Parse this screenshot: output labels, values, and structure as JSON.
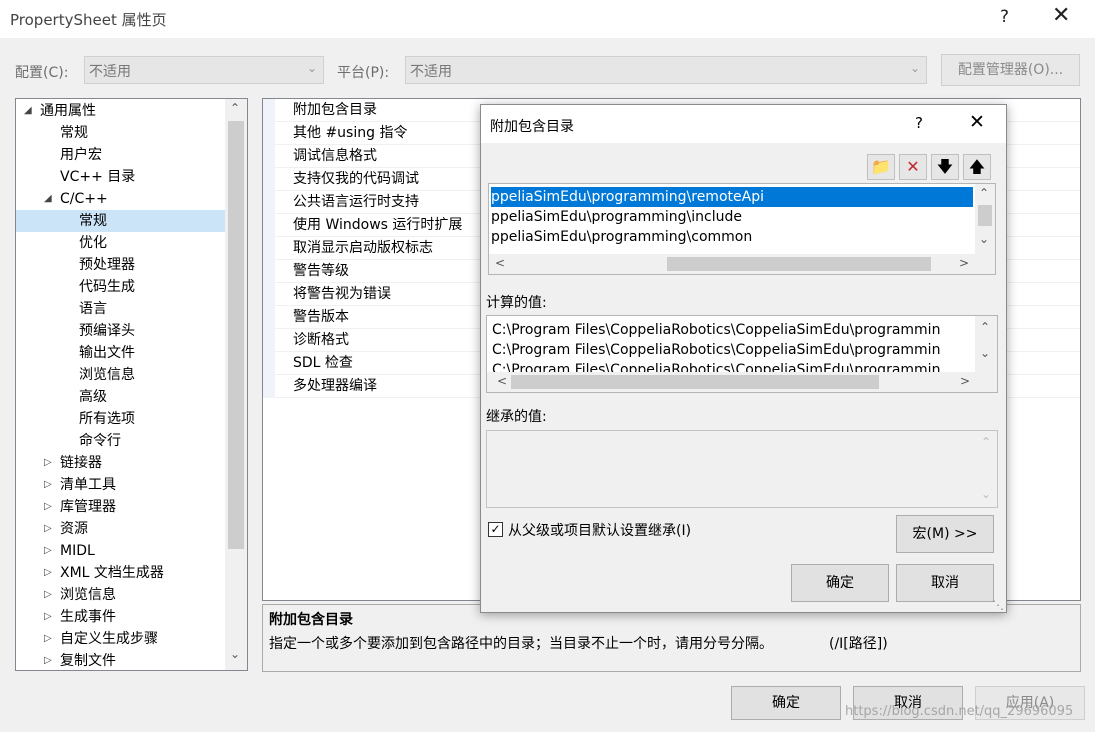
{
  "window": {
    "title": "PropertySheet 属性页",
    "help": "?",
    "close": "✕"
  },
  "config": {
    "label": "配置(C):",
    "value": "不适用",
    "platform_label": "平台(P):",
    "platform_value": "不适用",
    "manager_button": "配置管理器(O)..."
  },
  "tree": {
    "items": [
      {
        "label": "通用属性",
        "toggle": "◢"
      },
      {
        "label": "常规"
      },
      {
        "label": "用户宏"
      },
      {
        "label": "VC++ 目录"
      },
      {
        "label": "C/C++",
        "toggle": "◢"
      },
      {
        "label": "常规"
      },
      {
        "label": "优化"
      },
      {
        "label": "预处理器"
      },
      {
        "label": "代码生成"
      },
      {
        "label": "语言"
      },
      {
        "label": "预编译头"
      },
      {
        "label": "输出文件"
      },
      {
        "label": "浏览信息"
      },
      {
        "label": "高级"
      },
      {
        "label": "所有选项"
      },
      {
        "label": "命令行"
      },
      {
        "label": "链接器",
        "toggle": "▷"
      },
      {
        "label": "清单工具",
        "toggle": "▷"
      },
      {
        "label": "库管理器",
        "toggle": "▷"
      },
      {
        "label": "资源",
        "toggle": "▷"
      },
      {
        "label": "MIDL",
        "toggle": "▷"
      },
      {
        "label": "XML 文档生成器",
        "toggle": "▷"
      },
      {
        "label": "浏览信息",
        "toggle": "▷"
      },
      {
        "label": "生成事件",
        "toggle": "▷"
      },
      {
        "label": "自定义生成步骤",
        "toggle": "▷"
      },
      {
        "label": "复制文件",
        "toggle": "▷"
      }
    ],
    "scroll_up": "⌃",
    "scroll_down": "⌄"
  },
  "props": {
    "rows": [
      "附加包含目录",
      "其他 #using 指令",
      "调试信息格式",
      "支持仅我的代码调试",
      "公共语言运行时支持",
      "使用 Windows 运行时扩展",
      "取消显示启动版权标志",
      "警告等级",
      "将警告视为错误",
      "警告版本",
      "诊断格式",
      "SDL 检查",
      "多处理器编译"
    ]
  },
  "description": {
    "title": "附加包含目录",
    "text": "指定一个或多个要添加到包含路径中的目录；当目录不止一个时，请用分号分隔。",
    "switch": "(/I[路径])"
  },
  "dialog": {
    "title": "附加包含目录",
    "help": "?",
    "close": "✕",
    "tools": [
      "new-folder",
      "delete",
      "move-down",
      "move-up"
    ],
    "entries": [
      "ppeliaSimEdu\\programming\\remoteApi",
      "ppeliaSimEdu\\programming\\include",
      "ppeliaSimEdu\\programming\\common"
    ],
    "computed_label": "计算的值:",
    "computed": [
      "C:\\Program Files\\CoppeliaRobotics\\CoppeliaSimEdu\\programmin",
      "C:\\Program Files\\CoppeliaRobotics\\CoppeliaSimEdu\\programmin",
      "C:\\Program Files\\CoppeliaRobotics\\CoppeliaSimEdu\\programmin"
    ],
    "inherited_label": "继承的值:",
    "inherit_checkbox": "从父级或项目默认设置继承(I)",
    "macros_button": "宏(M) >>",
    "ok": "确定",
    "cancel": "取消"
  },
  "footer": {
    "ok": "确定",
    "cancel": "取消",
    "apply": "应用(A)",
    "watermark": "https://blog.csdn.net/qq_29696095"
  }
}
